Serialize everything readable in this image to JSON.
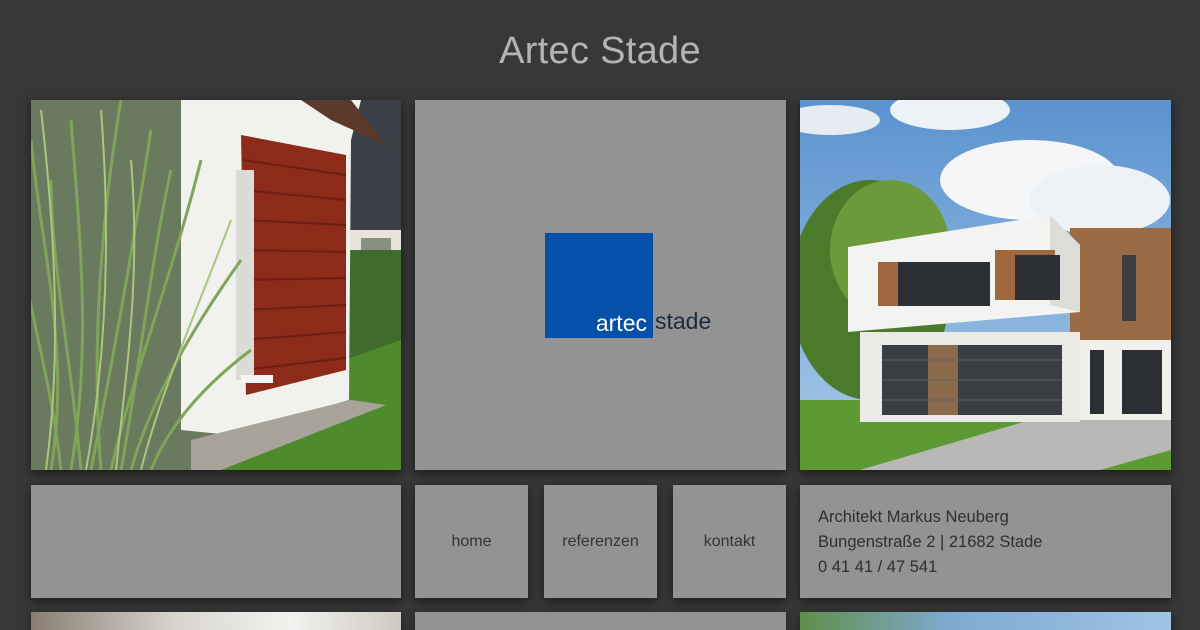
{
  "site": {
    "title": "Artec Stade"
  },
  "logo": {
    "part1": "artec",
    "part2": "stade",
    "box_color": "#0550a8"
  },
  "nav": {
    "items": [
      {
        "label": "home"
      },
      {
        "label": "referenzen"
      },
      {
        "label": "kontakt"
      }
    ]
  },
  "contact": {
    "name": "Architekt Markus Neuberg",
    "address": "Bungenstraße 2 | 21682 Stade",
    "phone": "0 41 41 / 47 541"
  },
  "colors": {
    "background": "#383838",
    "tile": "#939393",
    "title": "#b4b4b4"
  }
}
